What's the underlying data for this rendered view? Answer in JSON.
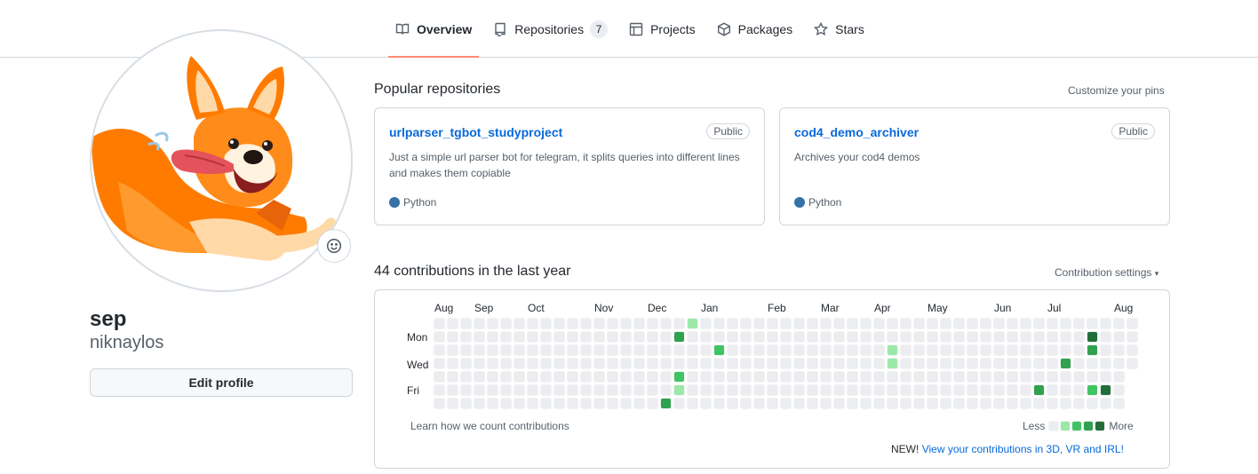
{
  "nav": {
    "tabs": [
      {
        "label": "Overview",
        "icon": "book-icon",
        "active": true
      },
      {
        "label": "Repositories",
        "icon": "repo-icon",
        "count": "7"
      },
      {
        "label": "Projects",
        "icon": "table-icon"
      },
      {
        "label": "Packages",
        "icon": "package-icon"
      },
      {
        "label": "Stars",
        "icon": "star-icon"
      }
    ]
  },
  "profile": {
    "name": "sep",
    "login": "niknaylos",
    "edit_label": "Edit profile",
    "avatar": "corgi-illustration"
  },
  "pinned": {
    "title": "Popular repositories",
    "customize_label": "Customize your pins",
    "repos": [
      {
        "name": "urlparser_tgbot_studyproject",
        "visibility": "Public",
        "description": "Just a simple url parser bot for telegram, it splits queries into different lines and makes them copiable",
        "language": "Python",
        "language_color": "#3572A5"
      },
      {
        "name": "cod4_demo_archiver",
        "visibility": "Public",
        "description": "Archives your cod4 demos",
        "language": "Python",
        "language_color": "#3572A5"
      }
    ]
  },
  "contributions": {
    "title": "44 contributions in the last year",
    "settings_label": "Contribution settings",
    "months": [
      "Aug",
      "Sep",
      "Oct",
      "Nov",
      "Dec",
      "Jan",
      "Feb",
      "Mar",
      "Apr",
      "May",
      "Jun",
      "Jul",
      "Aug"
    ],
    "days": [
      "Mon",
      "Wed",
      "Fri"
    ],
    "learn_label": "Learn how we count contributions",
    "legend_less": "Less",
    "legend_more": "More",
    "new_prefix": "NEW!",
    "new_link": "View your contributions in 3D, VR and IRL!",
    "colors": [
      "#ebedf0",
      "#9be9a8",
      "#40c463",
      "#30a14e",
      "#216e39"
    ],
    "week_count": 53,
    "last_week_days": 4,
    "active_cells": [
      {
        "week": 19,
        "day": 0,
        "level": 1
      },
      {
        "week": 18,
        "day": 1,
        "level": 3
      },
      {
        "week": 21,
        "day": 2,
        "level": 2
      },
      {
        "week": 18,
        "day": 4,
        "level": 2
      },
      {
        "week": 18,
        "day": 5,
        "level": 1
      },
      {
        "week": 17,
        "day": 6,
        "level": 3
      },
      {
        "week": 34,
        "day": 2,
        "level": 1
      },
      {
        "week": 34,
        "day": 3,
        "level": 1
      },
      {
        "week": 45,
        "day": 5,
        "level": 3
      },
      {
        "week": 47,
        "day": 3,
        "level": 3
      },
      {
        "week": 49,
        "day": 1,
        "level": 4
      },
      {
        "week": 49,
        "day": 2,
        "level": 3
      },
      {
        "week": 49,
        "day": 5,
        "level": 2
      },
      {
        "week": 50,
        "day": 5,
        "level": 4
      }
    ]
  }
}
